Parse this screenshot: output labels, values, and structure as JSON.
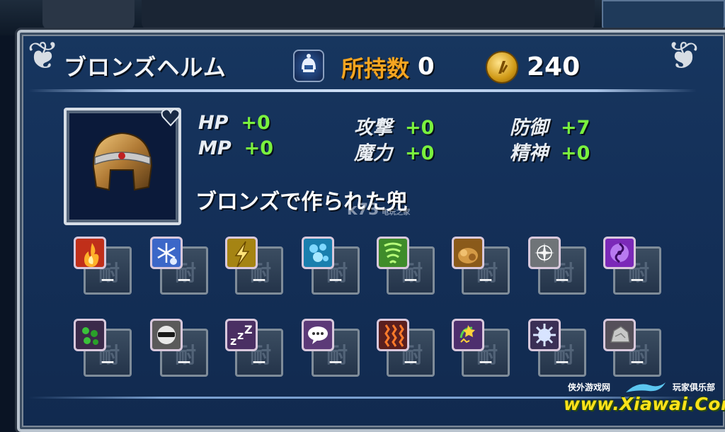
{
  "item": {
    "name": "ブロンズヘルム",
    "owned_label": "所持数",
    "owned_count": "0",
    "gil": "240",
    "description": "ブロンズで作られた兜",
    "type_icon": "armor-type-icon",
    "item_icon": "bronze-helm-icon"
  },
  "stats": [
    {
      "label": "HP",
      "value": "+0"
    },
    {
      "label": "攻撃",
      "value": "+0"
    },
    {
      "label": "防御",
      "value": "+7"
    },
    {
      "label": "MP",
      "value": "+0"
    },
    {
      "label": "魔力",
      "value": "+0"
    },
    {
      "label": "精神",
      "value": "+0"
    }
  ],
  "resistances": {
    "ghost_char": "耐",
    "row1": [
      {
        "icon": "fire-icon",
        "value": "ー",
        "color": "#c02f1a"
      },
      {
        "icon": "ice-icon",
        "value": "ー",
        "color": "#3c67c8"
      },
      {
        "icon": "lightning-icon",
        "value": "ー",
        "color": "#a58413"
      },
      {
        "icon": "water-icon",
        "value": "ー",
        "color": "#1a7fae"
      },
      {
        "icon": "wind-icon",
        "value": "ー",
        "color": "#3f8c2a"
      },
      {
        "icon": "earth-icon",
        "value": "ー",
        "color": "#8a5a1a"
      },
      {
        "icon": "holy-icon",
        "value": "ー",
        "color": "#6f7478"
      },
      {
        "icon": "dark-icon",
        "value": "ー",
        "color": "#7b29b8"
      }
    ],
    "row2": [
      {
        "icon": "poison-icon",
        "value": "ー",
        "color": "#3b2a4a"
      },
      {
        "icon": "blind-icon",
        "value": "ー",
        "color": "#5a5a5a"
      },
      {
        "icon": "sleep-icon",
        "value": "ー",
        "color": "#4a2f63"
      },
      {
        "icon": "silence-icon",
        "value": "ー",
        "color": "#5c3a78"
      },
      {
        "icon": "paralyze-icon",
        "value": "ー",
        "color": "#5a1f1f"
      },
      {
        "icon": "confuse-icon",
        "value": "ー",
        "color": "#4e2f6e"
      },
      {
        "icon": "disease-icon",
        "value": "ー",
        "color": "#3a2f55"
      },
      {
        "icon": "petrify-icon",
        "value": "ー",
        "color": "#55505a"
      }
    ]
  },
  "watermark": {
    "text": "k73",
    "sub": "电玩之家"
  },
  "branding": {
    "left": "侠外游戏网",
    "right": "玩家俱乐部",
    "url": "www.Xiawai.Com"
  },
  "colors": {
    "stat_value": "#7af23e",
    "owned_label": "#f5a521",
    "panel": "#143059"
  }
}
